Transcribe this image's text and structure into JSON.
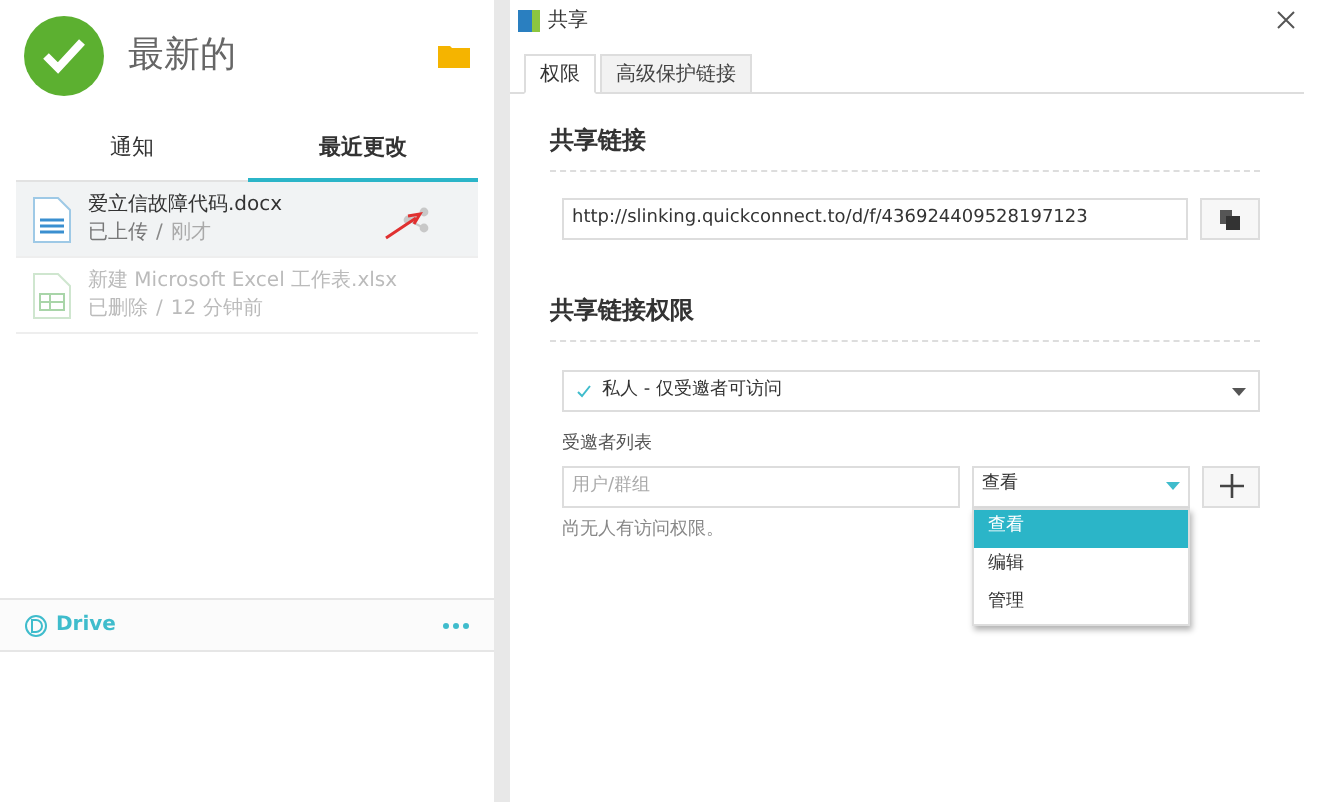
{
  "header": {
    "title": "最新的"
  },
  "tabs": [
    {
      "label": "通知",
      "selected": false
    },
    {
      "label": "最近更改",
      "selected": true
    }
  ],
  "files": [
    {
      "kind": "doc",
      "name": "爱立信故障代码.docx",
      "status": "已上传",
      "separator": "/",
      "time": "刚才",
      "selected": true,
      "deleted": false
    },
    {
      "kind": "sheet",
      "name": "新建 Microsoft Excel 工作表.xlsx",
      "status": "已删除",
      "separator": "/",
      "time": "12 分钟前",
      "selected": false,
      "deleted": true
    }
  ],
  "footer": {
    "label": "Drive"
  },
  "dialog": {
    "title": "共享",
    "tabs": [
      {
        "label": "权限",
        "selected": true
      },
      {
        "label": "高级保护链接",
        "selected": false
      }
    ],
    "link_heading": "共享链接",
    "url": "http://slinking.quickconnect.to/d/f/436924409528197123",
    "permission_heading": "共享链接权限",
    "privacy": "私人 - 仅受邀者可访问",
    "invitee_label": "受邀者列表",
    "invitee_placeholder": "用户/群组",
    "role": "查看",
    "role_options": [
      {
        "label": "查看",
        "selected": true
      },
      {
        "label": "编辑",
        "selected": false
      },
      {
        "label": "管理",
        "selected": false
      }
    ],
    "note": "尚无人有访问权限。"
  }
}
